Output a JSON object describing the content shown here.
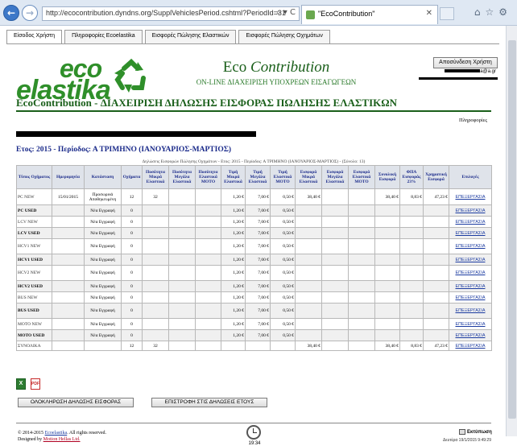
{
  "browser": {
    "url": "http://ecocontribution.dyndns.org/SupplVehiclesPeriod.cshtml?PeriodId=31",
    "tab_title": "\"EcoContribution\"",
    "addr_controls": "⌕ ▾ C"
  },
  "nav": {
    "tabs": [
      "Είσοδος Χρήστη",
      "Πληροφορίες Ecoelastika",
      "Εισφορές Πώλησης Ελαστικών",
      "Εισφορές Πώλησης Οχημάτων"
    ]
  },
  "logo": {
    "eco": "eco",
    "elastika": "elastika"
  },
  "brand": {
    "name_plain": "Eco ",
    "name_italic": "Contribution",
    "subtitle": "ON-LINE ΔΙΑΧΕΙΡΙΣΗ ΥΠΟΧΡΕΩΝ ΕΙΣΑΓΩΓΕΩΝ"
  },
  "user": {
    "logout_label": "Αποσύνδεση Χρήστη",
    "email_suffix": "a@a.gr"
  },
  "title": "EcoContribution - ΔΙΑΧΕΙΡΙΣΗ ΔΗΛΩΣΗΣ ΕΙΣΦΟΡΑΣ ΠΩΛΗΣΗΣ ΕΛΑΣΤΙΚΩΝ",
  "info_link": "Πληροφορίες",
  "period": "Ετος: 2015 - Περίοδος: Α ΤΡΙΜΗΝΟ (ΙΑΝΟΥΑΡΙΟΣ-ΜΑΡΤΙΟΣ)",
  "caption": "Δηλώσεις Εισφορών Πώλησης Οχημάτων - Ετος: 2015 - Περίοδος: Α ΤΡΙΜΗΝΟ (ΙΑΝΟΥΑΡΙΟΣ-ΜΑΡΤΙΟΣ) - (Σύνολο: 13)",
  "table": {
    "headers": [
      "Τύπος Οχήματος",
      "Ημερομηνία",
      "Κατάσταση",
      "Οχήματα",
      "Ποσότητα Μικρά Ελαστικά",
      "Ποσότητα Μεγάλα Ελαστικά",
      "Ποσότητα Ελαστικά ΜΟΤΟ",
      "Τιμή Μικρά Ελαστικά",
      "Τιμή Μεγάλα Ελαστικά",
      "Τιμή Ελαστικά ΜΟΤΟ",
      "Εισφορά Μικρά Ελαστικά",
      "Εισφορά Μεγάλα Ελαστικά",
      "Εισφορά Ελαστικά ΜΟΤΟ",
      "Συνολική Εισφορά",
      "ΦΠΑ Εισφοράς 23%",
      "Χρηματική Εισφορά",
      "Επιλογές"
    ],
    "rows": [
      {
        "type": "PC NEW",
        "bold": false,
        "date": "15/01/2015",
        "status": "Προσωρινά Αποθηκευμένη",
        "vehicles": "12",
        "qs": "32",
        "ql": "",
        "qm": "",
        "ps": "1,20 €",
        "pl": "7,00 €",
        "pm": "0,50 €",
        "cs": "38,40 €",
        "cl": "",
        "cm": "",
        "tot": "38,40 €",
        "vat": "8,83 €",
        "money": "47,23 €",
        "action": "ΕΠΕΞΕΡΓΑΣΙΑ"
      },
      {
        "type": "PC USED",
        "bold": true,
        "date": "",
        "status": "Νέα Εγγραφή",
        "vehicles": "0",
        "qs": "",
        "ql": "",
        "qm": "",
        "ps": "1,20 €",
        "pl": "7,00 €",
        "pm": "0,50 €",
        "cs": "",
        "cl": "",
        "cm": "",
        "tot": "",
        "vat": "",
        "money": "",
        "action": "ΕΠΕΞΕΡΓΑΣΙΑ"
      },
      {
        "type": "LCV NEW",
        "bold": false,
        "date": "",
        "status": "Νέα Εγγραφή",
        "vehicles": "0",
        "qs": "",
        "ql": "",
        "qm": "",
        "ps": "1,20 €",
        "pl": "7,00 €",
        "pm": "0,50 €",
        "cs": "",
        "cl": "",
        "cm": "",
        "tot": "",
        "vat": "",
        "money": "",
        "action": "ΕΠΕΞΕΡΓΑΣΙΑ"
      },
      {
        "type": "LCV USED",
        "bold": true,
        "date": "",
        "status": "Νέα Εγγραφή",
        "vehicles": "0",
        "qs": "",
        "ql": "",
        "qm": "",
        "ps": "1,20 €",
        "pl": "7,00 €",
        "pm": "0,50 €",
        "cs": "",
        "cl": "",
        "cm": "",
        "tot": "",
        "vat": "",
        "money": "",
        "action": "ΕΠΕΞΕΡΓΑΣΙΑ"
      },
      {
        "type": "HCV1 NEW",
        "bold": false,
        "date": "",
        "status": "Νέα Εγγραφή",
        "vehicles": "0",
        "qs": "",
        "ql": "",
        "qm": "",
        "ps": "1,20 €",
        "pl": "7,00 €",
        "pm": "0,50 €",
        "cs": "",
        "cl": "",
        "cm": "",
        "tot": "",
        "vat": "",
        "money": "",
        "action": "ΕΠΕΞΕΡΓΑΣΙΑ"
      },
      {
        "type": "HCV1 USED",
        "bold": true,
        "date": "",
        "status": "Νέα Εγγραφή",
        "vehicles": "0",
        "qs": "",
        "ql": "",
        "qm": "",
        "ps": "1,20 €",
        "pl": "7,00 €",
        "pm": "0,50 €",
        "cs": "",
        "cl": "",
        "cm": "",
        "tot": "",
        "vat": "",
        "money": "",
        "action": "ΕΠΕΞΕΡΓΑΣΙΑ"
      },
      {
        "type": "HCV2 NEW",
        "bold": false,
        "date": "",
        "status": "Νέα Εγγραφή",
        "vehicles": "0",
        "qs": "",
        "ql": "",
        "qm": "",
        "ps": "1,20 €",
        "pl": "7,00 €",
        "pm": "0,50 €",
        "cs": "",
        "cl": "",
        "cm": "",
        "tot": "",
        "vat": "",
        "money": "",
        "action": "ΕΠΕΞΕΡΓΑΣΙΑ"
      },
      {
        "type": "HCV2 USED",
        "bold": true,
        "date": "",
        "status": "Νέα Εγγραφή",
        "vehicles": "0",
        "qs": "",
        "ql": "",
        "qm": "",
        "ps": "1,20 €",
        "pl": "7,00 €",
        "pm": "0,50 €",
        "cs": "",
        "cl": "",
        "cm": "",
        "tot": "",
        "vat": "",
        "money": "",
        "action": "ΕΠΕΞΕΡΓΑΣΙΑ"
      },
      {
        "type": "BUS NEW",
        "bold": false,
        "date": "",
        "status": "Νέα Εγγραφή",
        "vehicles": "0",
        "qs": "",
        "ql": "",
        "qm": "",
        "ps": "1,20 €",
        "pl": "7,00 €",
        "pm": "0,50 €",
        "cs": "",
        "cl": "",
        "cm": "",
        "tot": "",
        "vat": "",
        "money": "",
        "action": "ΕΠΕΞΕΡΓΑΣΙΑ"
      },
      {
        "type": "BUS USED",
        "bold": true,
        "date": "",
        "status": "Νέα Εγγραφή",
        "vehicles": "0",
        "qs": "",
        "ql": "",
        "qm": "",
        "ps": "1,20 €",
        "pl": "7,00 €",
        "pm": "0,50 €",
        "cs": "",
        "cl": "",
        "cm": "",
        "tot": "",
        "vat": "",
        "money": "",
        "action": "ΕΠΕΞΕΡΓΑΣΙΑ"
      },
      {
        "type": "MOTO NEW",
        "bold": false,
        "date": "",
        "status": "Νέα Εγγραφή",
        "vehicles": "0",
        "qs": "",
        "ql": "",
        "qm": "",
        "ps": "1,20 €",
        "pl": "7,00 €",
        "pm": "0,50 €",
        "cs": "",
        "cl": "",
        "cm": "",
        "tot": "",
        "vat": "",
        "money": "",
        "action": "ΕΠΕΞΕΡΓΑΣΙΑ"
      },
      {
        "type": "MOTO USED",
        "bold": true,
        "date": "",
        "status": "Νέα Εγγραφή",
        "vehicles": "0",
        "qs": "",
        "ql": "",
        "qm": "",
        "ps": "1,20 €",
        "pl": "7,00 €",
        "pm": "0,50 €",
        "cs": "",
        "cl": "",
        "cm": "",
        "tot": "",
        "vat": "",
        "money": "",
        "action": "ΕΠΕΞΕΡΓΑΣΙΑ"
      }
    ],
    "totals": {
      "label": "ΣΥΝΟΛΙΚΑ",
      "vehicles": "12",
      "qs": "32",
      "cs": "38,40 €",
      "tot": "38,40 €",
      "vat": "8,83 €",
      "money": "47,23 €",
      "action": "ΕΠΕΞΕΡΓΑΣΙΑ"
    }
  },
  "export": {
    "xls_label": "X",
    "pdf_label": "PDF"
  },
  "actions": {
    "complete": "ΟΛΟΚΛΗΡΩΣΗ ΔΗΛΩΣΗΣ ΕΙΣΦΟΡΑΣ",
    "back": "ΕΠΙΣΤΡΟΦΗ ΣΤΙΣ ΔΗΛΩΣΕΙΣ ΕΤΟΥΣ"
  },
  "footer": {
    "copy_prefix": "© 2014-2015 ",
    "copy_link": "Ecoelastika",
    "copy_suffix": ". All rights reserved.",
    "designed_prefix": "Designed by ",
    "designed_link": "Motion Hellas Ltd.",
    "clock_time": "19:34",
    "print_label": "Εκτύπωση",
    "datestamp": "Δευτέρα 19/1/2015 9:49:29"
  }
}
